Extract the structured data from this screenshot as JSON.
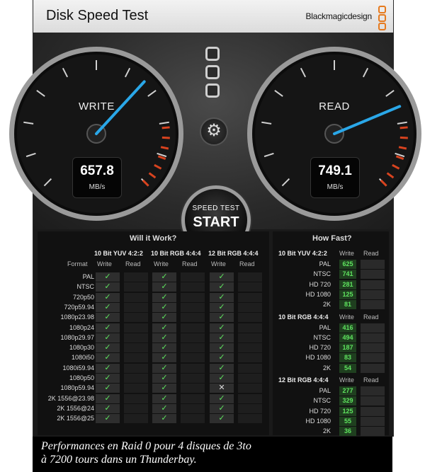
{
  "app": {
    "title": "Disk Speed Test",
    "brand": "Blackmagicdesign"
  },
  "write": {
    "label": "WRITE",
    "value": "657.8",
    "unit": "MB/s"
  },
  "read": {
    "label": "READ",
    "value": "749.1",
    "unit": "MB/s"
  },
  "start_button": {
    "line1": "SPEED TEST",
    "line2": "START"
  },
  "settings_icon": "gear-icon",
  "will_it_work": {
    "title": "Will it Work?",
    "format_header": "Format",
    "groups": [
      "10 Bit YUV 4:2:2",
      "10 Bit RGB 4:4:4",
      "12 Bit RGB 4:4:4"
    ],
    "sub_headers": [
      "Write",
      "Read"
    ],
    "formats": [
      "PAL",
      "NTSC",
      "720p50",
      "720p59.94",
      "1080p23.98",
      "1080p24",
      "1080p29.97",
      "1080p30",
      "1080i50",
      "1080i59.94",
      "1080p50",
      "1080p59.94",
      "2K 1556@23.98",
      "2K 1556@24",
      "2K 1556@25"
    ],
    "results": [
      [
        "✓",
        "✓",
        "✓"
      ],
      [
        "✓",
        "✓",
        "✓"
      ],
      [
        "✓",
        "✓",
        "✓"
      ],
      [
        "✓",
        "✓",
        "✓"
      ],
      [
        "✓",
        "✓",
        "✓"
      ],
      [
        "✓",
        "✓",
        "✓"
      ],
      [
        "✓",
        "✓",
        "✓"
      ],
      [
        "✓",
        "✓",
        "✓"
      ],
      [
        "✓",
        "✓",
        "✓"
      ],
      [
        "✓",
        "✓",
        "✓"
      ],
      [
        "✓",
        "✓",
        "✓"
      ],
      [
        "✓",
        "✓",
        "✕"
      ],
      [
        "✓",
        "✓",
        "✓"
      ],
      [
        "✓",
        "✓",
        "✓"
      ],
      [
        "✓",
        "✓",
        "✓"
      ]
    ]
  },
  "how_fast": {
    "title": "How Fast?",
    "sub_headers": [
      "Write",
      "Read"
    ],
    "groups": [
      {
        "name": "10 Bit YUV 4:2:2",
        "rows": [
          {
            "label": "PAL",
            "write": "625"
          },
          {
            "label": "NTSC",
            "write": "741"
          },
          {
            "label": "HD 720",
            "write": "281"
          },
          {
            "label": "HD 1080",
            "write": "125"
          },
          {
            "label": "2K",
            "write": "81"
          }
        ]
      },
      {
        "name": "10 Bit RGB 4:4:4",
        "rows": [
          {
            "label": "PAL",
            "write": "416"
          },
          {
            "label": "NTSC",
            "write": "494"
          },
          {
            "label": "HD 720",
            "write": "187"
          },
          {
            "label": "HD 1080",
            "write": "83"
          },
          {
            "label": "2K",
            "write": "54"
          }
        ]
      },
      {
        "name": "12 Bit RGB 4:4:4",
        "rows": [
          {
            "label": "PAL",
            "write": "277"
          },
          {
            "label": "NTSC",
            "write": "329"
          },
          {
            "label": "HD 720",
            "write": "125"
          },
          {
            "label": "HD 1080",
            "write": "55"
          },
          {
            "label": "2K",
            "write": "36"
          }
        ]
      }
    ]
  },
  "caption": {
    "line1": "Performances en Raid 0 pour 4 disques de 3to",
    "line2": "à 7200 tours dans un Thunderbay."
  },
  "colors": {
    "accent_needle": "#2aa7e8",
    "check": "#5fe55f",
    "redline": "#d8431f",
    "brand_logo": "#e67a1e"
  }
}
